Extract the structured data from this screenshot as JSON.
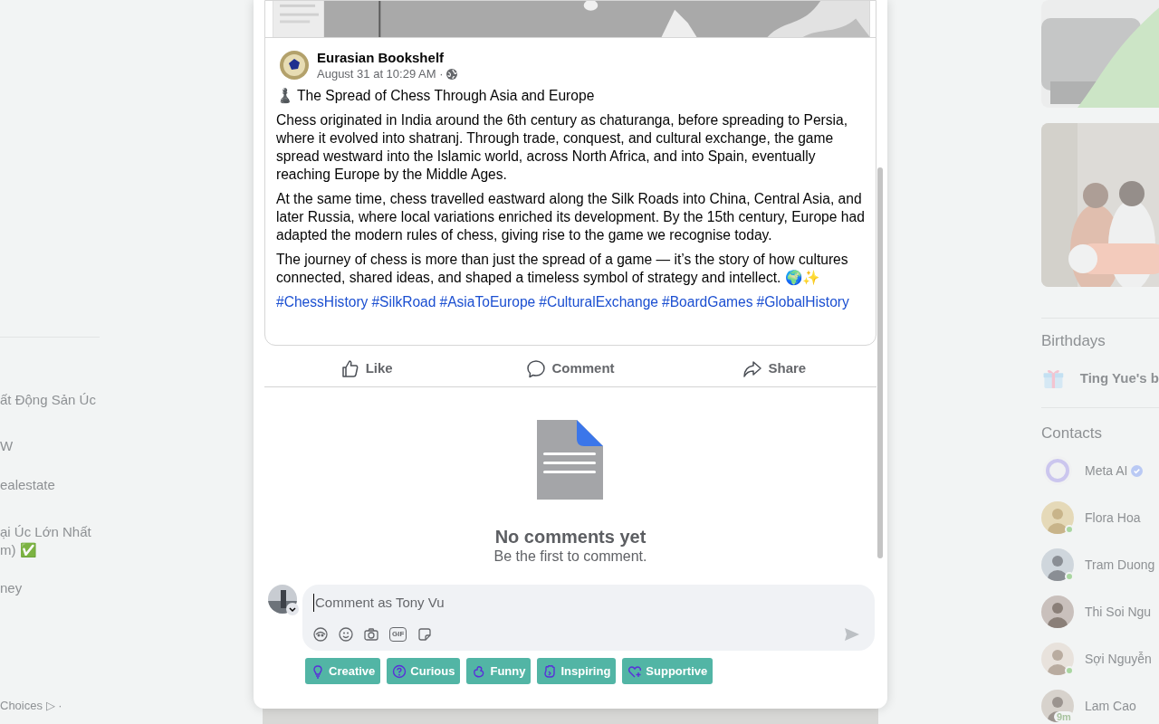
{
  "left_sidebar": {
    "items": [
      {
        "text": "ất Động Sản Úc"
      },
      {
        "text": "W"
      },
      {
        "text": "ealestate"
      },
      {
        "text": "ại Úc Lớn Nhất\nm) ✅"
      },
      {
        "text": "ney"
      }
    ],
    "footer": "Choices ▷ ·"
  },
  "right_sidebar": {
    "birthdays": {
      "title": "Birthdays",
      "text": "Ting Yue's b"
    },
    "contacts": {
      "title": "Contacts",
      "items": [
        {
          "name": "Meta AI",
          "kind": "ai",
          "verified": true,
          "online": false
        },
        {
          "name": "Flora Hoa",
          "kind": "person",
          "verified": false,
          "online": true
        },
        {
          "name": "Tram Duong",
          "kind": "person",
          "verified": false,
          "online": true
        },
        {
          "name": "Thi Soi Ngu",
          "kind": "person",
          "verified": false,
          "online": false
        },
        {
          "name": "Sợi Nguyễn",
          "kind": "person",
          "verified": false,
          "online": true
        },
        {
          "name": "Lam Cao",
          "kind": "person",
          "verified": false,
          "online": false,
          "away": "9m"
        }
      ]
    }
  },
  "post": {
    "author": "Eurasian Bookshelf",
    "time": "August 31 at 10:29 AM ·",
    "title": "♟️ The Spread of Chess Through Asia and Europe",
    "paragraphs": [
      "Chess originated in India around the 6th century as chaturanga, before spreading to Persia, where it evolved into shatranj. Through trade, conquest, and cultural exchange, the game spread westward into the Islamic world, across North Africa, and into Spain, eventually reaching Europe by the Middle Ages.",
      "At the same time, chess travelled eastward along the Silk Roads into China, Central Asia, and later Russia, where local variations enriched its development. By the 15th century, Europe had adapted the modern rules of chess, giving rise to the game we recognise today.",
      "The journey of chess is more than just the spread of a game — it’s the story of how cultures connected, shared ideas, and shaped a timeless symbol of strategy and intellect. 🌍✨"
    ],
    "hashtags": [
      "#ChessHistory",
      "#SilkRoad",
      "#AsiaToEurope",
      "#CulturalExchange",
      "#BoardGames",
      "#GlobalHistory"
    ],
    "actions": [
      {
        "kind": "like",
        "label": "Like"
      },
      {
        "kind": "comment",
        "label": "Comment"
      },
      {
        "kind": "share",
        "label": "Share"
      }
    ]
  },
  "comments": {
    "empty_title": "No comments yet",
    "empty_text": "Be the first to comment."
  },
  "composer": {
    "placeholder": "Comment as Tony Vu",
    "tools": [
      {
        "kind": "avatar"
      },
      {
        "kind": "emoji"
      },
      {
        "kind": "camera"
      },
      {
        "kind": "gif",
        "label": "GIF"
      },
      {
        "kind": "sticker"
      }
    ],
    "chips": [
      {
        "kind": "creative",
        "label": "Creative"
      },
      {
        "kind": "curious",
        "label": "Curious"
      },
      {
        "kind": "funny",
        "label": "Funny"
      },
      {
        "kind": "inspiring",
        "label": "Inspiring"
      },
      {
        "kind": "supportive",
        "label": "Supportive"
      }
    ]
  }
}
